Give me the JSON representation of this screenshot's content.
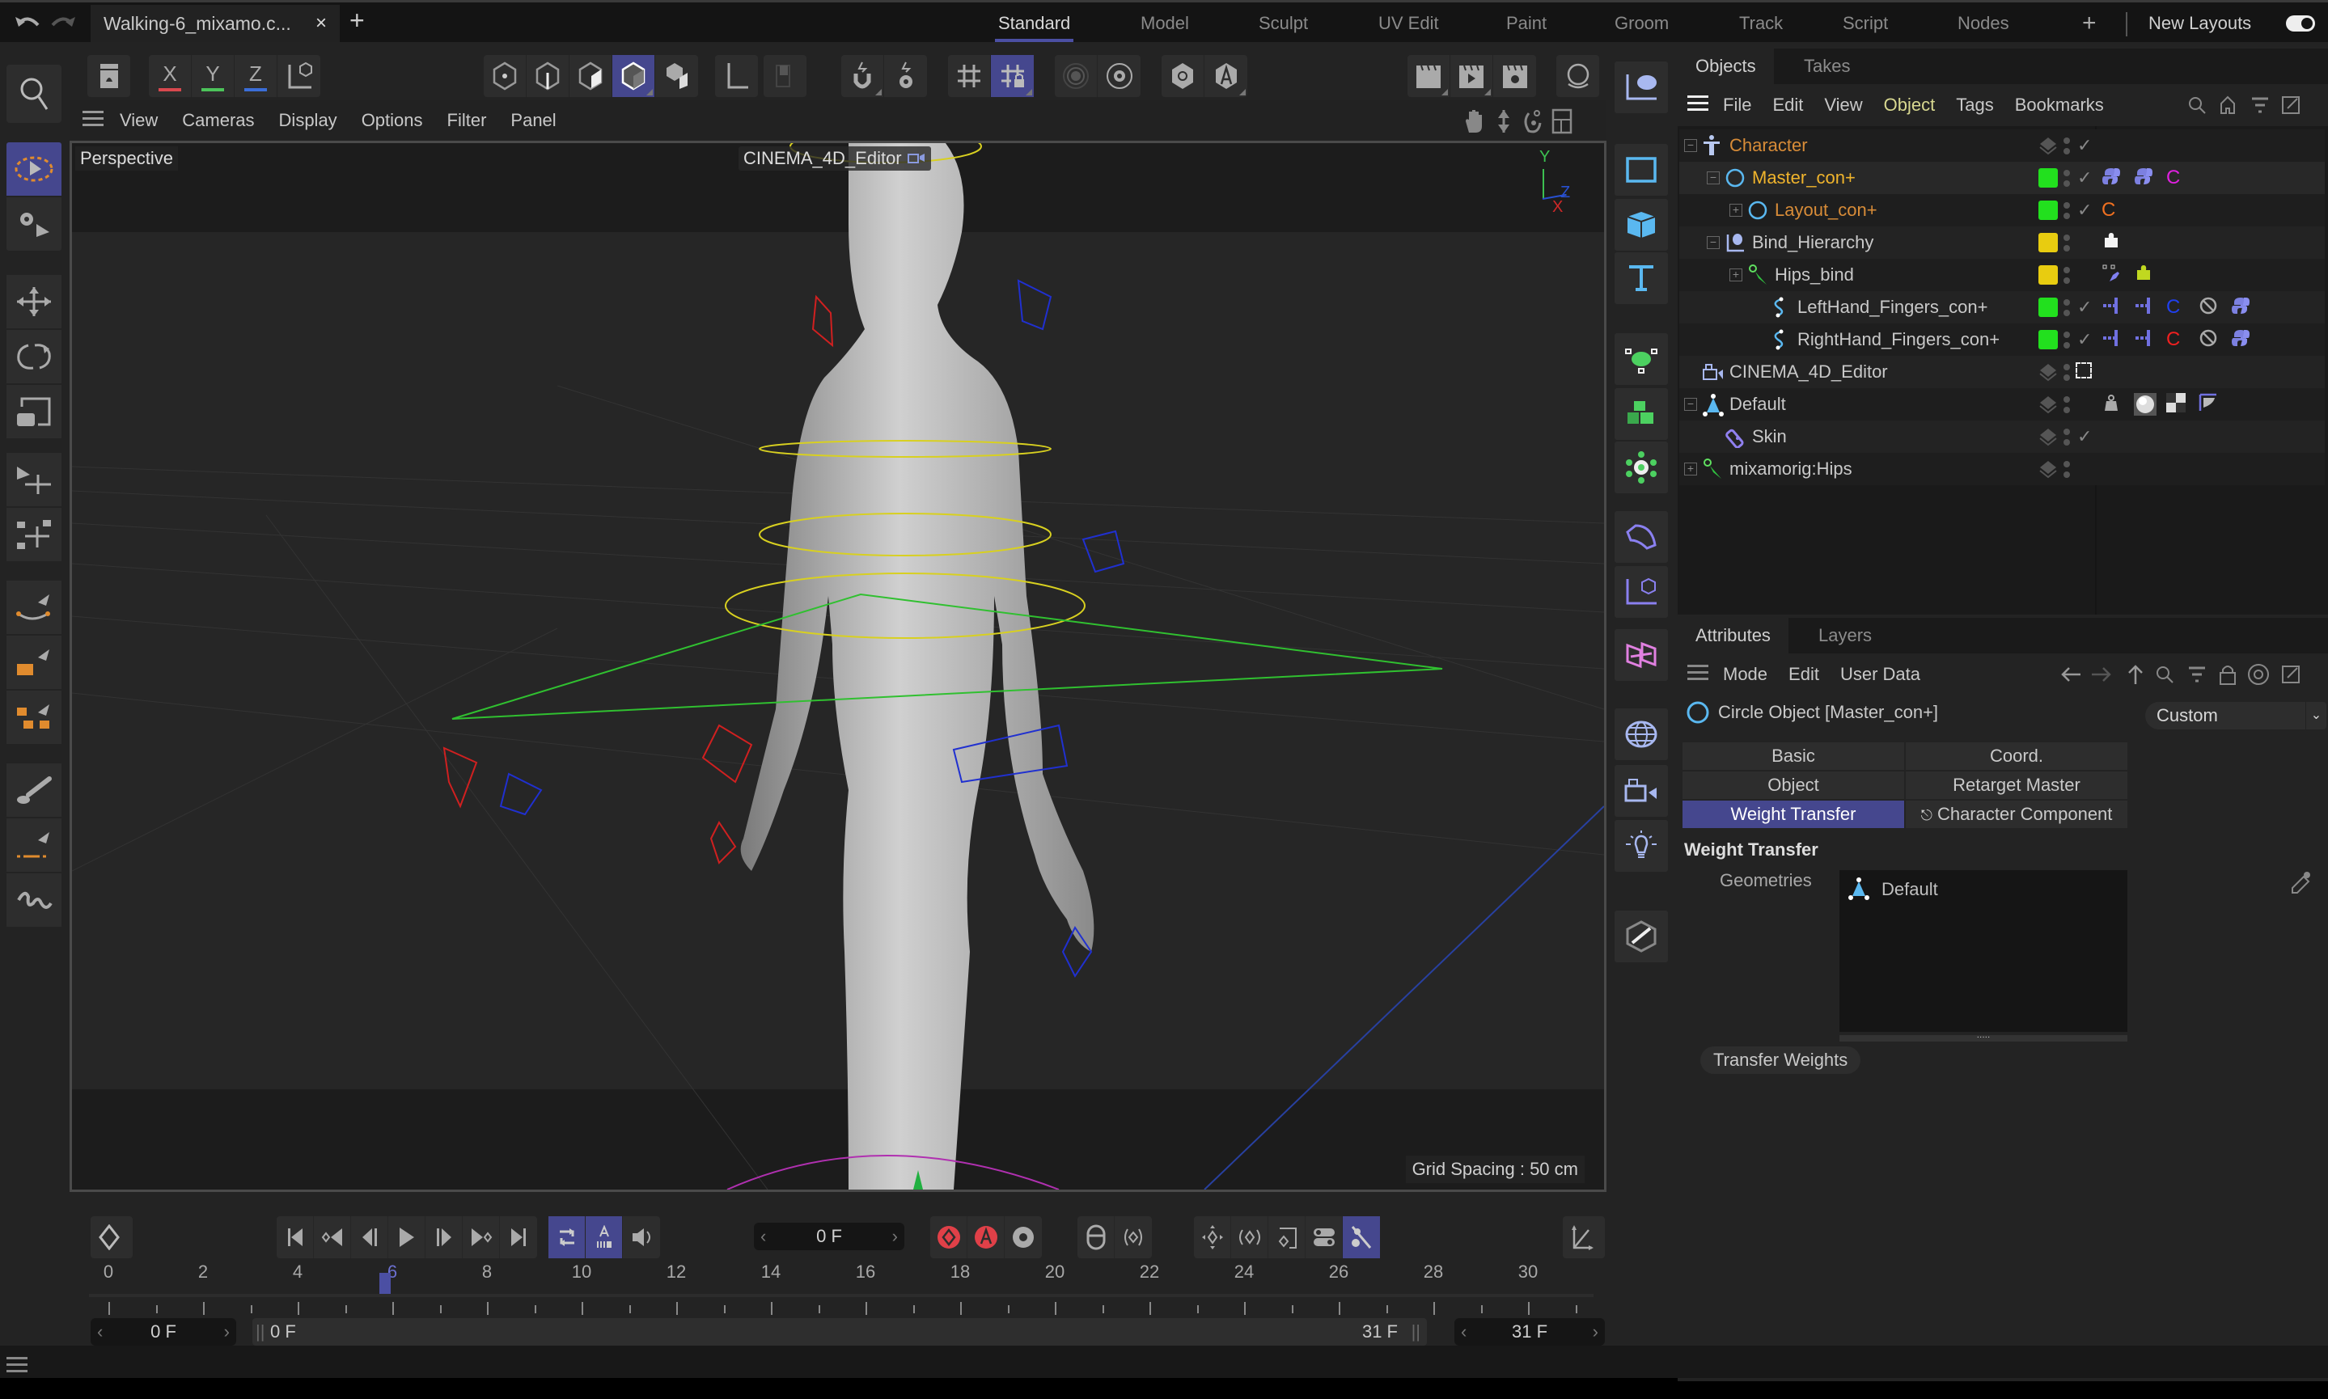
{
  "title_bar": {
    "document_tab": "Walking-6_mixamo.c...",
    "close_glyph": "×",
    "add_tab_glyph": "+",
    "layouts": [
      "Standard",
      "Model",
      "Sculpt",
      "UV Edit",
      "Paint",
      "Groom",
      "Track",
      "Script",
      "Nodes"
    ],
    "active_layout": "Standard",
    "add_layout_glyph": "+",
    "new_layouts_label": "New Layouts"
  },
  "toolbar": {
    "axis_x": "X",
    "axis_y": "Y",
    "axis_z": "Z",
    "axis_colors": {
      "x": "#d9484e",
      "y": "#4cc35a",
      "z": "#3b6ed8"
    },
    "accent": "#45478e"
  },
  "viewport": {
    "menu": [
      "View",
      "Cameras",
      "Display",
      "Options",
      "Filter",
      "Panel"
    ],
    "camera_label": "Perspective",
    "active_camera": "CINEMA_4D_Editor",
    "grid_spacing": "Grid Spacing : 50 cm",
    "axis_labels": {
      "y": "Y",
      "x": "X",
      "z": "Z"
    }
  },
  "object_manager": {
    "tabs": [
      "Objects",
      "Takes"
    ],
    "menu": [
      "File",
      "Edit",
      "View",
      "Object",
      "Tags",
      "Bookmarks"
    ],
    "active_menu": "Object",
    "objects": [
      {
        "name": "Character",
        "color": "#d88c38",
        "indent": 0,
        "expander": "minus",
        "icon": "character-icon",
        "swatch": null,
        "check": true,
        "tags": []
      },
      {
        "name": "Master_con+",
        "color": "#f0b42c",
        "indent": 1,
        "expander": "minus",
        "icon": "circle-spline-icon",
        "swatch": "#22e01e",
        "check": true,
        "tags": [
          "python",
          "python",
          "C-magenta"
        ],
        "selected": true
      },
      {
        "name": "Layout_con+",
        "color": "#d88c38",
        "indent": 2,
        "expander": "plus",
        "icon": "circle-spline-icon",
        "swatch": "#22e01e",
        "check": true,
        "tags": [
          "C-orange"
        ]
      },
      {
        "name": "Bind_Hierarchy",
        "color": "#c8c8c8",
        "indent": 1,
        "expander": "minus",
        "icon": "null-icon",
        "swatch": "#e8cc10",
        "check": false,
        "tags": [
          "puzzle-white"
        ]
      },
      {
        "name": "Hips_bind",
        "color": "#c8c8c8",
        "indent": 2,
        "expander": "plus",
        "icon": "joint-icon",
        "swatch": "#e8cc10",
        "check": false,
        "tags": [
          "pin",
          "puzzle-yellow"
        ]
      },
      {
        "name": "LeftHand_Fingers_con+",
        "color": "#c8c8c8",
        "indent": 3,
        "expander": null,
        "icon": "spline-icon",
        "swatch": "#22e01e",
        "check": true,
        "tags": [
          "constraint",
          "constraint",
          "C-blue",
          "forbidden",
          "python"
        ]
      },
      {
        "name": "RightHand_Fingers_con+",
        "color": "#c8c8c8",
        "indent": 3,
        "expander": null,
        "icon": "spline-icon",
        "swatch": "#22e01e",
        "check": true,
        "tags": [
          "constraint",
          "constraint",
          "C-red",
          "forbidden",
          "python"
        ]
      },
      {
        "name": "CINEMA_4D_Editor",
        "color": "#c8c8c8",
        "indent": 0,
        "expander": null,
        "icon": "camera-icon",
        "swatch": null,
        "check": false,
        "tags": []
      },
      {
        "name": "Default",
        "color": "#c8c8c8",
        "indent": 0,
        "expander": "minus",
        "icon": "polygon-icon",
        "swatch": null,
        "check": false,
        "tags": [
          "weight",
          "material",
          "checker",
          "phong"
        ]
      },
      {
        "name": "Skin",
        "color": "#c8c8c8",
        "indent": 1,
        "expander": null,
        "icon": "skin-icon",
        "swatch": null,
        "check": true,
        "tags": []
      },
      {
        "name": "mixamorig:Hips",
        "color": "#c8c8c8",
        "indent": 0,
        "expander": "plus",
        "icon": "joint-icon",
        "swatch": null,
        "check": false,
        "tags": []
      }
    ]
  },
  "attributes": {
    "tabs": [
      "Attributes",
      "Layers"
    ],
    "menu": [
      "Mode",
      "Edit",
      "User Data"
    ],
    "object_title": "Circle Object [Master_con+]",
    "preset": "Custom",
    "sections": [
      "Basic",
      "Coord.",
      "Object",
      "Retarget Master",
      "Weight Transfer",
      "Character Component"
    ],
    "active_section": "Weight Transfer",
    "group_title": "Weight Transfer",
    "geometries_label": "Geometries",
    "geometries": [
      "Default"
    ],
    "transfer_button": "Transfer Weights"
  },
  "timeline": {
    "current_frame": "0 F",
    "ruler_ticks": [
      "0",
      "2",
      "4",
      "6",
      "8",
      "10",
      "12",
      "14",
      "16",
      "18",
      "20",
      "22",
      "24",
      "26",
      "28",
      "30"
    ],
    "playhead_frame": 6,
    "range_start": "0 F",
    "range_min": "0 F",
    "range_max": "31 F",
    "range_end": "31 F",
    "total_frames": 31
  }
}
